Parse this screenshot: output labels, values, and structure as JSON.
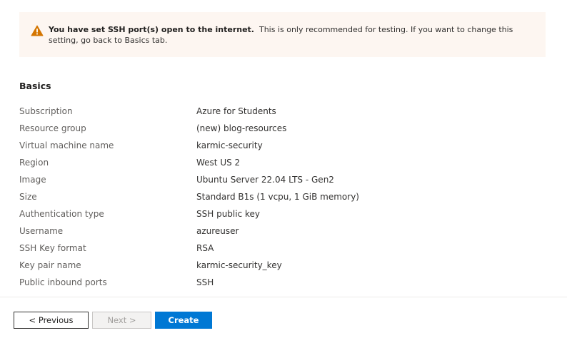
{
  "warning": {
    "icon": "warning-triangle-icon",
    "icon_color": "#d47500",
    "bold_text": "You have set SSH port(s) open to the internet.",
    "text": "This is only recommended for testing.  If you want to change this setting, go back to Basics tab."
  },
  "basics": {
    "title": "Basics",
    "rows": [
      {
        "label": "Subscription",
        "value": "Azure for Students"
      },
      {
        "label": "Resource group",
        "value": "(new) blog-resources"
      },
      {
        "label": "Virtual machine name",
        "value": "karmic-security"
      },
      {
        "label": "Region",
        "value": "West US 2"
      },
      {
        "label": "Image",
        "value": "Ubuntu Server 22.04 LTS - Gen2"
      },
      {
        "label": "Size",
        "value": "Standard B1s (1 vcpu, 1 GiB memory)"
      },
      {
        "label": "Authentication type",
        "value": "SSH public key"
      },
      {
        "label": "Username",
        "value": "azureuser"
      },
      {
        "label": "SSH Key format",
        "value": "RSA"
      },
      {
        "label": "Key pair name",
        "value": "karmic-security_key"
      },
      {
        "label": "Public inbound ports",
        "value": "SSH"
      }
    ]
  },
  "footer": {
    "previous_label": "< Previous",
    "next_label": "Next >",
    "create_label": "Create",
    "accent_color": "#0078d4"
  }
}
